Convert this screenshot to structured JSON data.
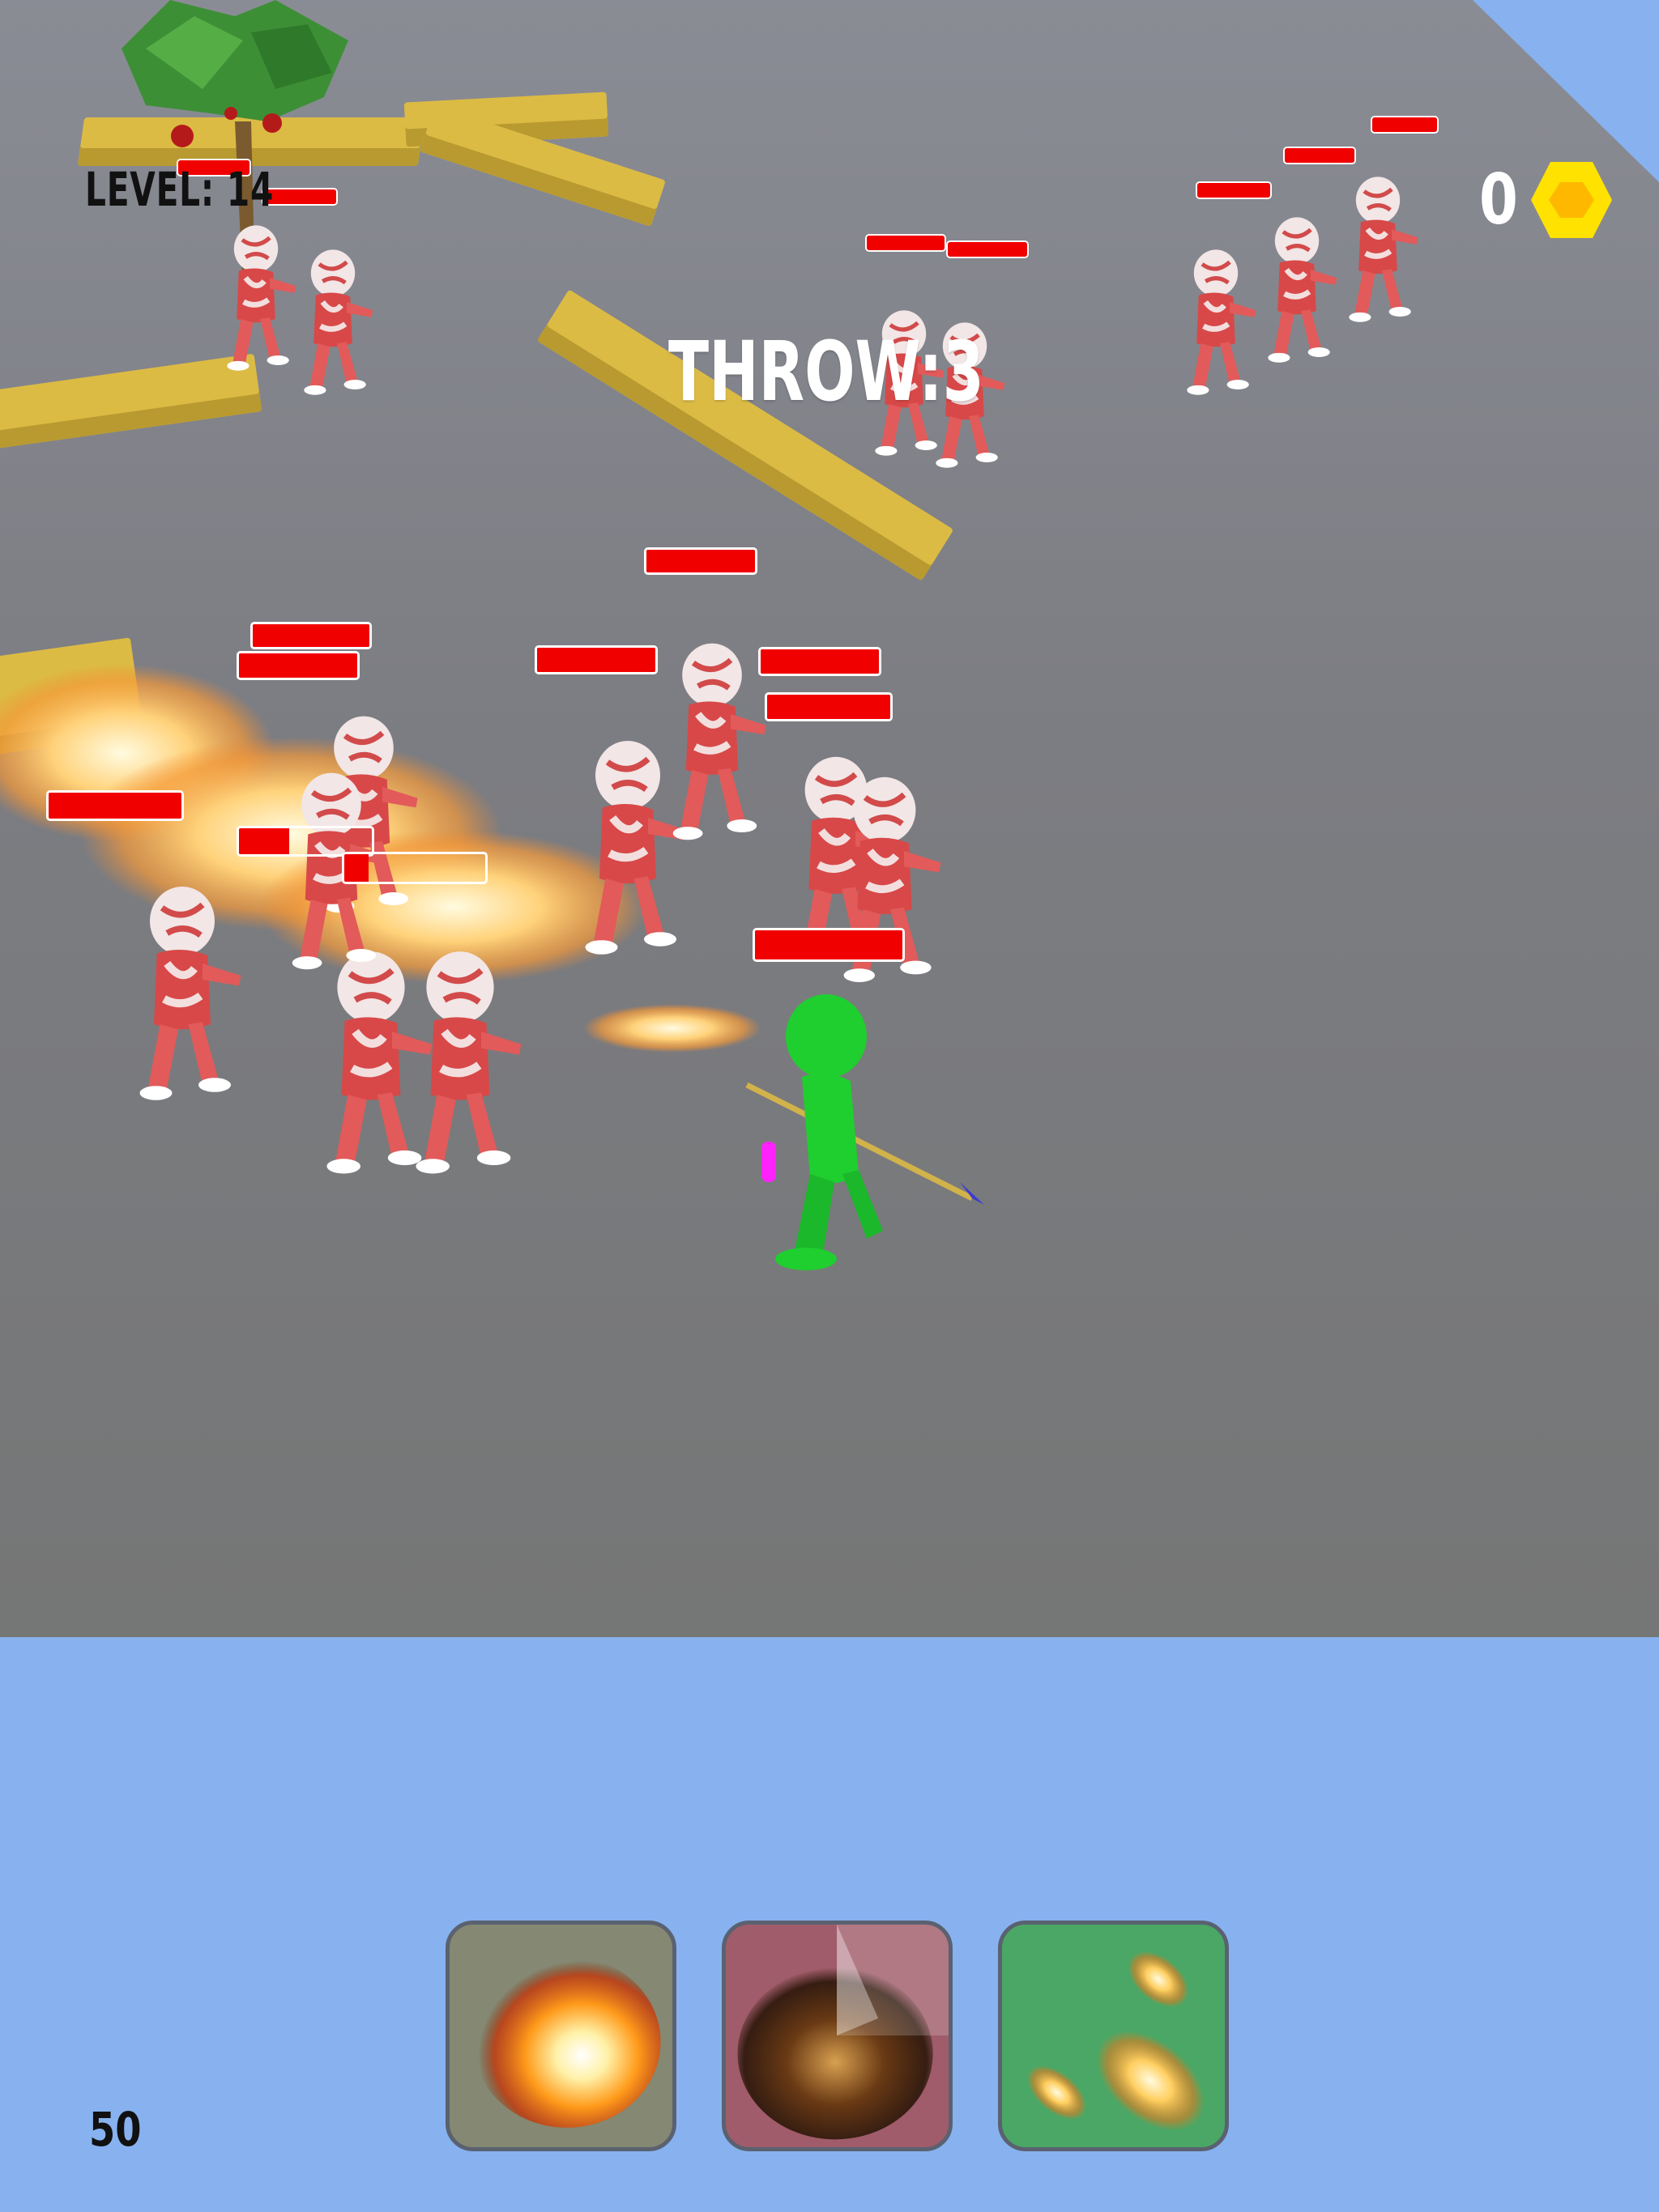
{
  "hud": {
    "level_text": "LEVEL: 14",
    "throw_text": "THROW:3",
    "coin_count": "0",
    "bottom_counter": "50"
  },
  "skills": [
    {
      "name": "fireball",
      "icon": "fireball-icon",
      "bg": "#858872"
    },
    {
      "name": "meteor",
      "icon": "meteor-icon",
      "bg": "#a05c6a"
    },
    {
      "name": "meteor-shower",
      "icon": "meteor-shower-icon",
      "bg": "#4aa766"
    }
  ],
  "colors": {
    "health_bar": "#f10000",
    "player": "#1fce2f",
    "coin": "#ffe200",
    "sky": "#87b2ef",
    "wall": "#dcbb44"
  }
}
